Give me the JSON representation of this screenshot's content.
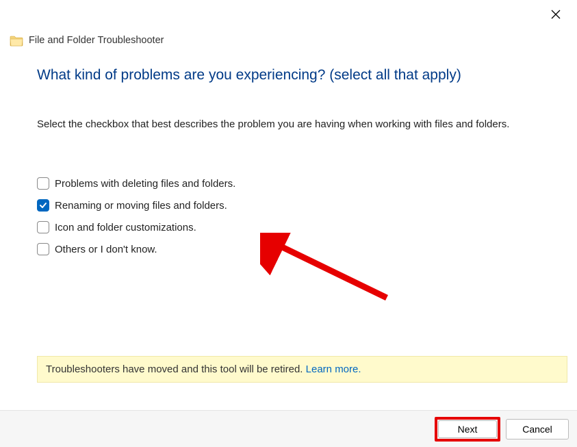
{
  "window": {
    "title": "File and Folder Troubleshooter"
  },
  "main": {
    "heading": "What kind of problems are you experiencing? (select all that apply)",
    "instruction": "Select the checkbox that best describes the problem you are having when working with files and folders.",
    "options": [
      {
        "label": "Problems with deleting files and folders.",
        "checked": false
      },
      {
        "label": "Renaming or moving files and folders.",
        "checked": true
      },
      {
        "label": "Icon and folder customizations.",
        "checked": false
      },
      {
        "label": "Others or I don't know.",
        "checked": false
      }
    ]
  },
  "notice": {
    "text": "Troubleshooters have moved and this tool will be retired. ",
    "link_text": "Learn more."
  },
  "footer": {
    "next": "Next",
    "cancel": "Cancel"
  },
  "annotation": {
    "arrow_points_to": "option-renaming-moving",
    "highlight": "next-button"
  }
}
